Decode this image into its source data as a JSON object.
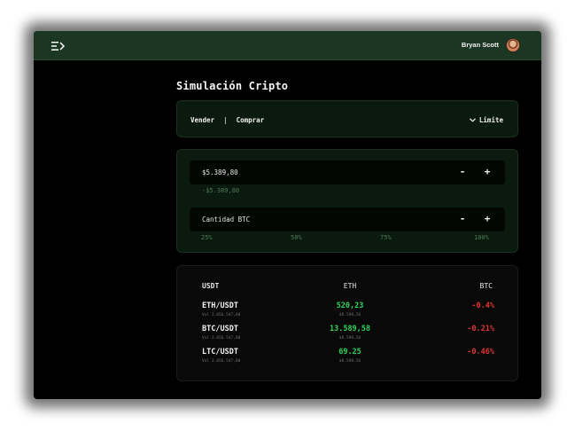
{
  "header": {
    "user_name": "Bryan Scott",
    "menu_icon": "menu-collapse-icon",
    "avatar_icon": "avatar"
  },
  "page": {
    "title": "Simulación Cripto"
  },
  "trade": {
    "sell_label": "Vender",
    "separator": "|",
    "buy_label": "Comprar",
    "order_type": "Limite",
    "order_type_icon": "chevron-down-icon"
  },
  "form": {
    "price_value": "$5.389,80",
    "price_sub": "-$5.389,80",
    "qty_placeholder": "Cantidad BTC",
    "minus": "-",
    "plus": "+",
    "percents": [
      "25%",
      "50%",
      "75%",
      "100%"
    ]
  },
  "market": {
    "headers": [
      "USDT",
      "ETH",
      "BTC"
    ],
    "rows": [
      {
        "pair": "ETH/USDT",
        "vol": "Vol 2.056.547,80",
        "price": "520,23",
        "sub": "$8.598,56",
        "change": "-0.4%"
      },
      {
        "pair": "BTC/USDT",
        "vol": "Vol 2.056.547,80",
        "price": "13.589,58",
        "sub": "$8.598,56",
        "change": "-0.21%"
      },
      {
        "pair": "LTC/USDT",
        "vol": "Vol 2.056.547,80",
        "price": "69.25",
        "sub": "$8.598,56",
        "change": "-0.46%"
      }
    ]
  },
  "colors": {
    "topbar": "#1b3622",
    "positive": "#2fd35b",
    "negative": "#e23434",
    "muted_green": "#4f7a56"
  }
}
